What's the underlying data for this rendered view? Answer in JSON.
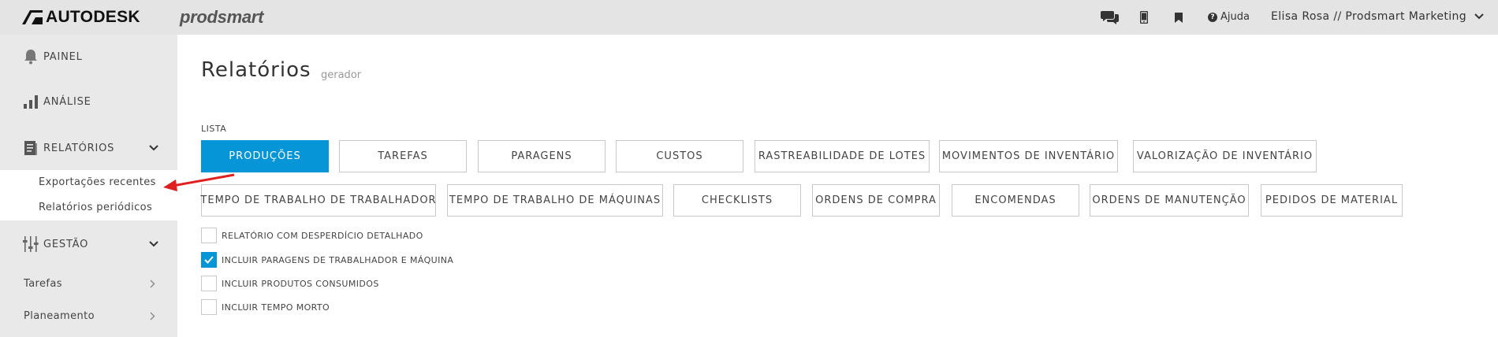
{
  "header": {
    "brand": "AUTODESK",
    "product": "prodsmart",
    "help_label": "Ajuda",
    "user_label": "Elisa Rosa // Prodsmart Marketing",
    "icons": [
      "chat-icon",
      "mobile-icon",
      "bookmark-icon",
      "help-icon",
      "chevron-down-icon"
    ]
  },
  "sidebar": {
    "items": [
      {
        "label": "PAINEL",
        "icon": "bell-icon"
      },
      {
        "label": "ANÁLISE",
        "icon": "bar-chart-icon"
      },
      {
        "label": "RELATÓRIOS",
        "icon": "report-icon"
      },
      {
        "label": "GESTÃO",
        "icon": "sliders-icon"
      }
    ],
    "sub_items": [
      "Exportações recentes",
      "Relatórios periódicos"
    ],
    "plain_items": [
      "Tarefas",
      "Planeamento"
    ]
  },
  "main": {
    "title": "Relatórios",
    "subtitle": "gerador",
    "list_label": "LISTA",
    "buttons_row1": [
      "PRODUÇÕES",
      "TAREFAS",
      "PARAGENS",
      "CUSTOS",
      "RASTREABILIDADE DE LOTES",
      "MOVIMENTOS DE INVENTÁRIO",
      "VALORIZAÇÃO DE INVENTÁRIO"
    ],
    "buttons_row2": [
      "TEMPO DE TRABALHO DE TRABALHADOR",
      "TEMPO DE TRABALHO DE MÁQUINAS",
      "CHECKLISTS",
      "ORDENS DE COMPRA",
      "ENCOMENDAS",
      "ORDENS DE MANUTENÇÃO",
      "PEDIDOS DE MATERIAL"
    ],
    "active_button": "PRODUÇÕES",
    "options": [
      {
        "label": "RELATÓRIO COM DESPERDÍCIO DETALHADO",
        "checked": false
      },
      {
        "label": "INCLUIR PARAGENS DE TRABALHADOR E MÁQUINA",
        "checked": true
      },
      {
        "label": "INCLUIR PRODUTOS CONSUMIDOS",
        "checked": false
      },
      {
        "label": "INCLUIR TEMPO MORTO",
        "checked": false
      }
    ]
  },
  "colors": {
    "accent": "#0696d7",
    "topbar": "#e4e4e4",
    "sidebar": "#e9e9e9",
    "annotation_arrow": "#e02020"
  }
}
